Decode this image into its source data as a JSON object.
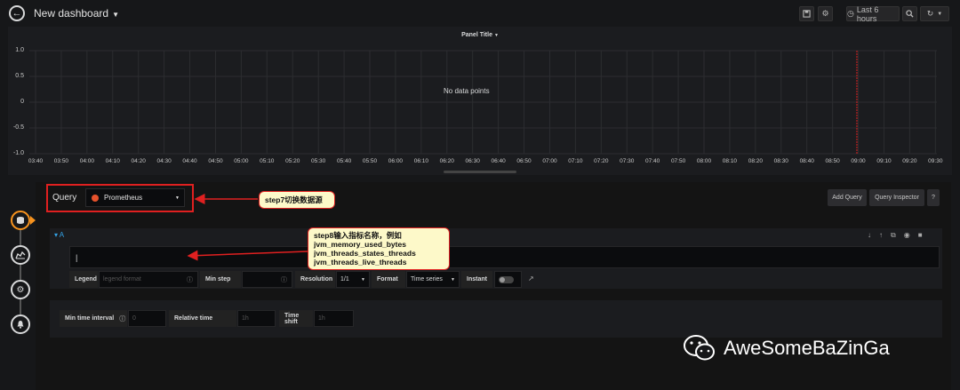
{
  "header": {
    "title": "New dashboard",
    "time_range": "Last 6 hours",
    "icons": {
      "back": "arrow-left-icon",
      "save": "save-icon",
      "settings": "gear-icon",
      "clock": "clock-icon",
      "zoom": "zoom-out-icon",
      "refresh": "refresh-icon"
    }
  },
  "panel": {
    "title": "Panel Title",
    "no_data": "No data points",
    "y_ticks": [
      "1.0",
      "0.5",
      "0",
      "-0.5",
      "-1.0"
    ],
    "x_ticks": [
      "03:40",
      "03:50",
      "04:00",
      "04:10",
      "04:20",
      "04:30",
      "04:40",
      "04:50",
      "05:00",
      "05:10",
      "05:20",
      "05:30",
      "05:40",
      "05:50",
      "06:00",
      "06:10",
      "06:20",
      "06:30",
      "06:40",
      "06:50",
      "07:00",
      "07:10",
      "07:20",
      "07:30",
      "07:40",
      "07:50",
      "08:00",
      "08:10",
      "08:20",
      "08:30",
      "08:40",
      "08:50",
      "09:00",
      "09:10",
      "09:20",
      "09:30"
    ],
    "now_marker_color": "#e02020"
  },
  "query": {
    "label": "Query",
    "datasource": "Prometheus",
    "add_query": "Add Query",
    "inspector": "Query Inspector",
    "help": "?",
    "row_label": "A",
    "expr_value": "|",
    "legend_label": "Legend",
    "legend_placeholder": "legend format",
    "min_step_label": "Min step",
    "resolution_label": "Resolution",
    "resolution_value": "1/1",
    "format_label": "Format",
    "format_value": "Time series",
    "instant_label": "Instant"
  },
  "options": {
    "min_interval_label": "Min time interval",
    "min_interval_placeholder": "0",
    "relative_label": "Relative time",
    "relative_placeholder": "1h",
    "shift_label": "Time shift",
    "shift_placeholder": "1h"
  },
  "annotations": {
    "step7": "step7切换数据源",
    "step8_lines": [
      "step8输入指标名称，例如",
      "jvm_memory_used_bytes",
      "jvm_threads_states_threads",
      "jvm_threads_live_threads"
    ]
  },
  "watermark": "AweSomeBaZinGa",
  "colors": {
    "accent": "#f7931e",
    "annotation_red": "#e02020",
    "callout_bg": "#fdf9c9",
    "prometheus": "#e6522c"
  }
}
